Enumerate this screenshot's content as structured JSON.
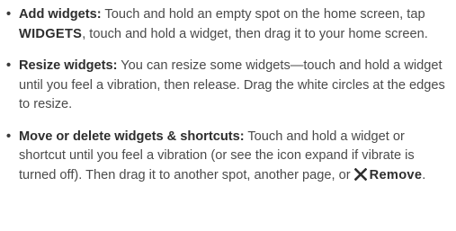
{
  "bullets": [
    {
      "term": "Add widgets:",
      "text_before": " Touch and hold an empty spot on the home screen, tap ",
      "ui_word": "WIDGETS",
      "text_after": ", touch and hold a widget, then drag it to your home screen."
    },
    {
      "term": "Resize widgets:",
      "text": " You can resize some widgets—touch and hold a widget until you feel a vibration, then release. Drag the white circles at the edges to resize."
    },
    {
      "term": "Move or delete widgets & shortcuts:",
      "text_before": " Touch and hold a widget or shortcut until you feel a vibration (or see the icon expand if vibrate is turned off). Then drag it to another spot, another page, or ",
      "icon": "close-x-icon",
      "ui_word": "Remove",
      "text_after": "."
    }
  ],
  "colors": {
    "text": "#4a4a4a",
    "bold": "#2e2e2e"
  }
}
